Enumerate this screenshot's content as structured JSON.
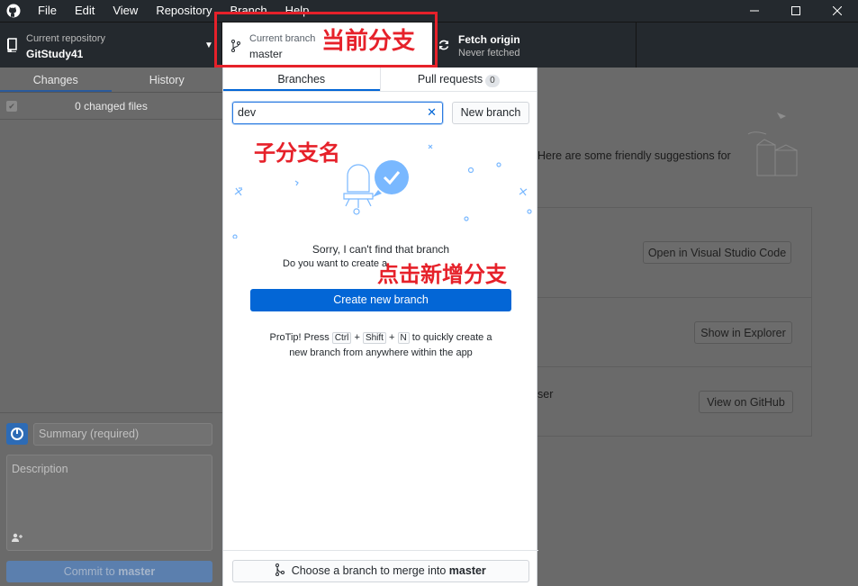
{
  "menu": [
    "File",
    "Edit",
    "View",
    "Repository",
    "Branch",
    "Help"
  ],
  "toolbar": {
    "repo_label": "Current repository",
    "repo_name": "GitStudy41",
    "branch_label": "Current branch",
    "branch_name": "master",
    "fetch_label": "Fetch origin",
    "fetch_status": "Never fetched"
  },
  "sidebar": {
    "tabs": [
      "Changes",
      "History"
    ],
    "changed_files": "0 changed files",
    "summary_placeholder": "Summary (required)",
    "description_placeholder": "Description",
    "commit_prefix": "Commit to ",
    "commit_branch": "master"
  },
  "main": {
    "suggestions_text": "Here are some friendly suggestions for",
    "open_vscode": "Open in Visual Studio Code",
    "show_explorer": "Show in Explorer",
    "view_github": "View on GitHub",
    "ser_fragment": "ser"
  },
  "dropdown": {
    "tab_branches": "Branches",
    "tab_pull_requests": "Pull requests",
    "pull_request_count": "0",
    "filter_value": "dev",
    "new_branch": "New branch",
    "sorry": "Sorry, I can't find that branch",
    "do_you_want": "Do you want to create a",
    "create_new_branch": "Create new branch",
    "protip_prefix": "ProTip! Press",
    "key_ctrl": "Ctrl",
    "key_shift": "Shift",
    "key_n": "N",
    "protip_suffix": "to quickly create a",
    "protip_line2": "new branch from anywhere within the app",
    "merge_prefix": "Choose a branch to merge into ",
    "merge_branch": "master"
  },
  "annotations": {
    "current_branch": "当前分支",
    "sub_branch_name": "子分支名",
    "click_new_branch": "点击新增分支",
    "color": "#e6212a"
  },
  "colors": {
    "titlebar": "#24292e",
    "accent_blue": "#0366d6",
    "overlay_gray": "#6a6a6a"
  }
}
